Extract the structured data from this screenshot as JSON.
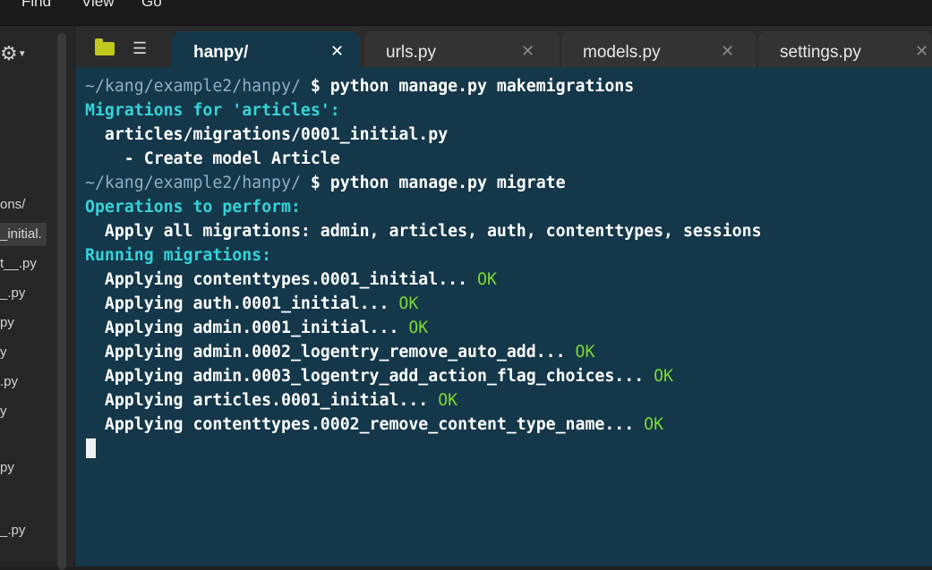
{
  "menu": [
    "Find",
    "View",
    "Go"
  ],
  "sidebar": {
    "items": [
      {
        "label": "ons/",
        "selected": false
      },
      {
        "label": "_initial.",
        "selected": true
      },
      {
        "label": "t__.py",
        "selected": false
      },
      {
        "label": "_.py",
        "selected": false
      },
      {
        "label": "py",
        "selected": false
      },
      {
        "label": "y",
        "selected": false
      },
      {
        "label": ".py",
        "selected": false
      },
      {
        "label": "y",
        "selected": false
      },
      {
        "label": "py",
        "selected": false
      },
      {
        "label": "_.py",
        "selected": false
      }
    ]
  },
  "tabs": [
    {
      "label": "hanpy/",
      "active": true
    },
    {
      "label": "urls.py",
      "active": false
    },
    {
      "label": "models.py",
      "active": false
    },
    {
      "label": "settings.py",
      "active": false
    }
  ],
  "terminal": {
    "lines": [
      {
        "segments": [
          {
            "text": "~/kang/example2/hanpy/",
            "style": "path"
          },
          {
            "text": " $ python manage.py makemigrations",
            "style": "cmd"
          }
        ]
      },
      {
        "segments": [
          {
            "text": "Migrations for 'articles':",
            "style": "cyan"
          }
        ]
      },
      {
        "segments": [
          {
            "text": "  articles/migrations/0001_initial.py",
            "style": "cmd"
          }
        ]
      },
      {
        "segments": [
          {
            "text": "    - Create model Article",
            "style": "cmd"
          }
        ]
      },
      {
        "segments": [
          {
            "text": "~/kang/example2/hanpy/",
            "style": "path"
          },
          {
            "text": " $ python manage.py migrate",
            "style": "cmd"
          }
        ]
      },
      {
        "segments": [
          {
            "text": "Operations to perform:",
            "style": "cyan"
          }
        ]
      },
      {
        "segments": [
          {
            "text": "  Apply all migrations: admin, articles, auth, contenttypes, sessions",
            "style": "cmd"
          }
        ]
      },
      {
        "segments": [
          {
            "text": "Running migrations:",
            "style": "cyan"
          }
        ]
      },
      {
        "segments": [
          {
            "text": "  Applying contenttypes.0001_initial... ",
            "style": "cmd"
          },
          {
            "text": "OK",
            "style": "ok"
          }
        ]
      },
      {
        "segments": [
          {
            "text": "  Applying auth.0001_initial... ",
            "style": "cmd"
          },
          {
            "text": "OK",
            "style": "ok"
          }
        ]
      },
      {
        "segments": [
          {
            "text": "  Applying admin.0001_initial... ",
            "style": "cmd"
          },
          {
            "text": "OK",
            "style": "ok"
          }
        ]
      },
      {
        "segments": [
          {
            "text": "  Applying admin.0002_logentry_remove_auto_add... ",
            "style": "cmd"
          },
          {
            "text": "OK",
            "style": "ok"
          }
        ]
      },
      {
        "segments": [
          {
            "text": "  Applying admin.0003_logentry_add_action_flag_choices... ",
            "style": "cmd"
          },
          {
            "text": "OK",
            "style": "ok"
          }
        ]
      },
      {
        "segments": [
          {
            "text": "  Applying articles.0001_initial... ",
            "style": "cmd"
          },
          {
            "text": "OK",
            "style": "ok"
          }
        ]
      },
      {
        "segments": [
          {
            "text": "  Applying contenttypes.0002_remove_content_type_name... ",
            "style": "cmd"
          },
          {
            "text": "OK",
            "style": "ok"
          }
        ]
      }
    ]
  },
  "colors": {
    "terminal_bg": "#14374a",
    "prompt_path": "#8fb0c8",
    "info_cyan": "#35d3d9",
    "ok_green": "#7dd934",
    "folder_icon": "#c2c91d"
  },
  "icons": {
    "settings": "gear-icon",
    "files": "folder-icon",
    "outline": "list-icon",
    "close": "close-icon"
  }
}
